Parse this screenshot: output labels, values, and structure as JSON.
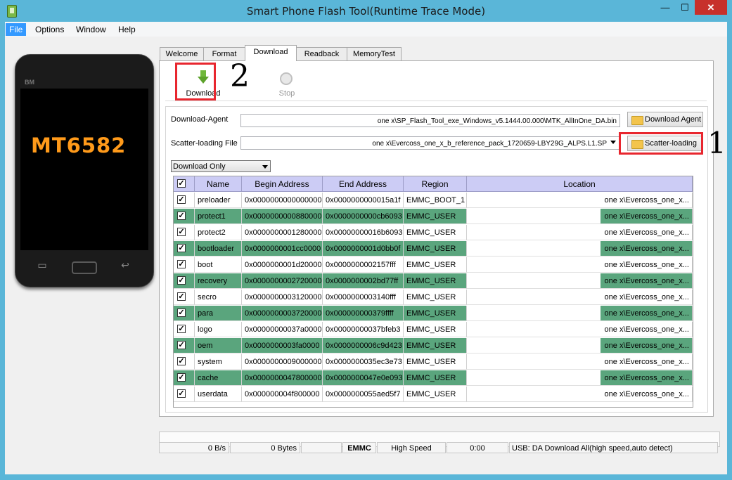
{
  "window": {
    "title": "Smart Phone Flash Tool(Runtime Trace Mode)",
    "minimize": "—",
    "maximize": "☐",
    "close": "✕"
  },
  "menu": [
    "File",
    "Options",
    "Window",
    "Help"
  ],
  "phone": {
    "brand": "BM",
    "chip": "MT6582"
  },
  "tabs": [
    "Welcome",
    "Format",
    "Download",
    "Readback",
    "MemoryTest"
  ],
  "toolbar": {
    "download": "Download",
    "stop": "Stop"
  },
  "annotations": {
    "one": "1",
    "two": "2"
  },
  "form": {
    "da_label": "Download-Agent",
    "da_value": "one x\\SP_Flash_Tool_exe_Windows_v5.1444.00.000\\MTK_AllInOne_DA.bin",
    "da_button": "Download Agent",
    "scatter_label": "Scatter-loading File",
    "scatter_value": "one x\\Evercoss_one_x_b_reference_pack_1720659-LBY29G_ALPS.L1.SP",
    "scatter_button": "Scatter-loading",
    "mode": "Download Only"
  },
  "table": {
    "headers": [
      "Name",
      "Begin Address",
      "End Address",
      "Region",
      "Location"
    ],
    "rows": [
      {
        "name": "preloader",
        "begin": "0x0000000000000000",
        "end": "0x0000000000015a1f",
        "region": "EMMC_BOOT_1",
        "location": "one x\\Evercoss_one_x...",
        "hl": false
      },
      {
        "name": "protect1",
        "begin": "0x0000000000880000",
        "end": "0x0000000000cb6093",
        "region": "EMMC_USER",
        "location": "one x\\Evercoss_one_x...",
        "hl": true
      },
      {
        "name": "protect2",
        "begin": "0x0000000001280000",
        "end": "0x00000000016b6093",
        "region": "EMMC_USER",
        "location": "one x\\Evercoss_one_x...",
        "hl": false
      },
      {
        "name": "bootloader",
        "begin": "0x0000000001cc0000",
        "end": "0x0000000001d0bb0f",
        "region": "EMMC_USER",
        "location": "one x\\Evercoss_one_x...",
        "hl": true
      },
      {
        "name": "boot",
        "begin": "0x0000000001d20000",
        "end": "0x0000000002157fff",
        "region": "EMMC_USER",
        "location": "one x\\Evercoss_one_x...",
        "hl": false
      },
      {
        "name": "recovery",
        "begin": "0x0000000002720000",
        "end": "0x0000000002bd77ff",
        "region": "EMMC_USER",
        "location": "one x\\Evercoss_one_x...",
        "hl": true
      },
      {
        "name": "secro",
        "begin": "0x0000000003120000",
        "end": "0x0000000003140fff",
        "region": "EMMC_USER",
        "location": "one x\\Evercoss_one_x...",
        "hl": false
      },
      {
        "name": "para",
        "begin": "0x0000000003720000",
        "end": "0x000000000379ffff",
        "region": "EMMC_USER",
        "location": "one x\\Evercoss_one_x...",
        "hl": true
      },
      {
        "name": "logo",
        "begin": "0x00000000037a0000",
        "end": "0x00000000037bfeb3",
        "region": "EMMC_USER",
        "location": "one x\\Evercoss_one_x...",
        "hl": false
      },
      {
        "name": "oem",
        "begin": "0x0000000003fa0000",
        "end": "0x0000000006c9d423",
        "region": "EMMC_USER",
        "location": "one x\\Evercoss_one_x...",
        "hl": true
      },
      {
        "name": "system",
        "begin": "0x0000000009000000",
        "end": "0x0000000035ec3e73",
        "region": "EMMC_USER",
        "location": "one x\\Evercoss_one_x...",
        "hl": false
      },
      {
        "name": "cache",
        "begin": "0x0000000047800000",
        "end": "0x0000000047e0e093",
        "region": "EMMC_USER",
        "location": "one x\\Evercoss_one_x...",
        "hl": true
      },
      {
        "name": "userdata",
        "begin": "0x000000004f800000",
        "end": "0x0000000055aed5f7",
        "region": "EMMC_USER",
        "location": "one x\\Evercoss_one_x...",
        "hl": false
      }
    ]
  },
  "status": {
    "speed": "0 B/s",
    "bytes": "0 Bytes",
    "storage": "EMMC",
    "mode": "High Speed",
    "time": "0:00",
    "message": "USB: DA Download All(high speed,auto detect)"
  },
  "colors": {
    "highlight": "#5aa57d",
    "header": "#ccccf5",
    "titlebar": "#5ab6d8",
    "annotation": "#e8262e"
  }
}
